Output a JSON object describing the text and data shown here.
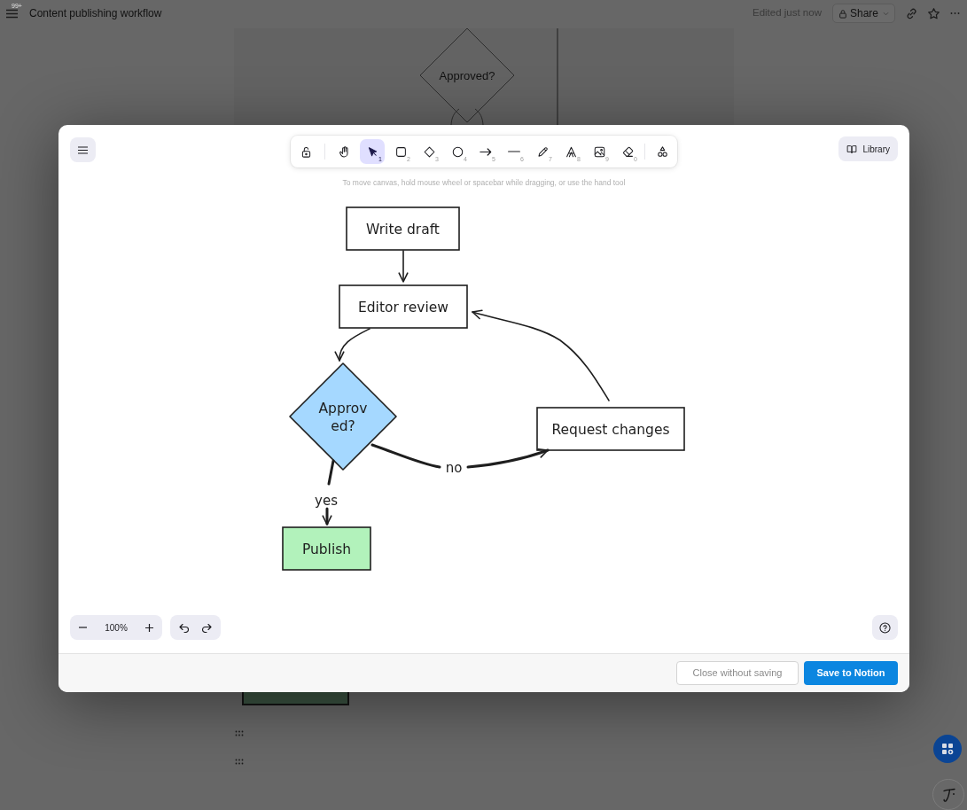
{
  "top_bar": {
    "notification_badge": "99+",
    "title": "Content publishing workflow",
    "edited_status": "Edited just now",
    "share_label": "Share"
  },
  "page_preview": {
    "decision_label": "Approved?"
  },
  "editor": {
    "toolbar": {
      "tools": [
        {
          "kind": "lock",
          "selected": false
        },
        {
          "kind": "hand",
          "selected": false
        },
        {
          "kind": "select",
          "shortcut": "1",
          "selected": true
        },
        {
          "kind": "rectangle",
          "shortcut": "2",
          "selected": false
        },
        {
          "kind": "diamond",
          "shortcut": "3",
          "selected": false
        },
        {
          "kind": "ellipse",
          "shortcut": "4",
          "selected": false
        },
        {
          "kind": "arrow",
          "shortcut": "5",
          "selected": false
        },
        {
          "kind": "line",
          "shortcut": "6",
          "selected": false
        },
        {
          "kind": "draw",
          "shortcut": "7",
          "selected": false
        },
        {
          "kind": "text",
          "shortcut": "8",
          "selected": false
        },
        {
          "kind": "image",
          "shortcut": "9",
          "selected": false
        },
        {
          "kind": "eraser",
          "shortcut": "0",
          "selected": false
        },
        {
          "kind": "more",
          "selected": false
        }
      ]
    },
    "library_label": "Library",
    "hint": "To move canvas, hold mouse wheel or spacebar while dragging, or use the hand tool",
    "diagram": {
      "nodes": [
        {
          "kind": "rectangle",
          "lines": [
            "Write draft"
          ]
        },
        {
          "kind": "rectangle",
          "lines": [
            "Editor review"
          ]
        },
        {
          "kind": "diamond",
          "lines": [
            "Approv",
            "ed?"
          ],
          "color": "#a5d8ff"
        },
        {
          "kind": "rectangle",
          "lines": [
            "Request changes"
          ]
        },
        {
          "kind": "rectangle",
          "lines": [
            "Publish"
          ],
          "color": "#b2f2bb"
        }
      ],
      "connectors": [
        {
          "kind": "arrow"
        },
        {
          "kind": "arrow"
        },
        {
          "kind": "arrow"
        },
        {
          "kind": "labeled-arrow",
          "label": "no"
        },
        {
          "kind": "labeled-arrow",
          "label": "yes"
        }
      ]
    },
    "zoom_label": "100%",
    "footer_buttons": [
      {
        "kind": "secondary",
        "label": "Close without saving"
      },
      {
        "kind": "primary",
        "label": "Save to Notion"
      }
    ]
  }
}
